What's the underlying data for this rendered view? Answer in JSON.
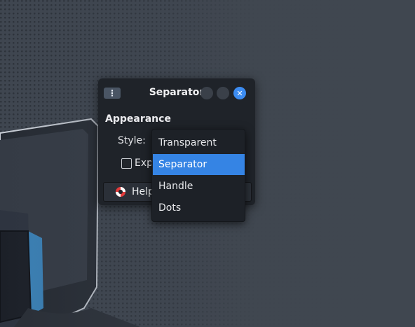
{
  "dialog": {
    "title": "Separator",
    "menu_icon": "vertical-dots-icon",
    "window_buttons": [
      "minimize-button",
      "maximize-button",
      "close-button"
    ]
  },
  "appearance": {
    "section_title": "Appearance",
    "style_label": "Style:",
    "expand_label": "Exp",
    "expand_checked": false
  },
  "help_button": {
    "label": "Help",
    "icon": "lifebuoy-icon"
  },
  "style_menu": {
    "items": [
      {
        "label": "Transparent",
        "selected": false
      },
      {
        "label": "Separator",
        "selected": true
      },
      {
        "label": "Handle",
        "selected": false
      },
      {
        "label": "Dots",
        "selected": false
      }
    ]
  },
  "colors": {
    "accent": "#3584e4",
    "dialog_bg": "#1f2329",
    "wallpaper": "#404750"
  }
}
